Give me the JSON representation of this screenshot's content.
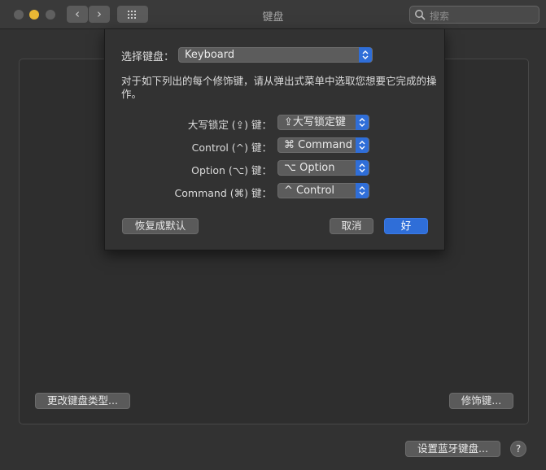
{
  "window": {
    "title": "键盘",
    "search_placeholder": "搜索"
  },
  "panel": {
    "change_type_label": "更改键盘类型...",
    "modifier_label": "修饰键...",
    "bluetooth_label": "设置蓝牙键盘...",
    "help_label": "?"
  },
  "sheet": {
    "select_label": "选择键盘：",
    "keyboard_value": "Keyboard",
    "description": "对于如下列出的每个修饰键，请从弹出式菜单中选取您想要它完成的操作。",
    "rows": [
      {
        "label": "大写锁定 (⇪) 键：",
        "value": "⇪大写锁定键"
      },
      {
        "label": "Control (^) 键：",
        "value": "⌘ Command"
      },
      {
        "label": "Option (⌥) 键：",
        "value": "⌥ Option"
      },
      {
        "label": "Command (⌘) 键：",
        "value": "^ Control"
      }
    ],
    "restore_label": "恢复成默认",
    "cancel_label": "取消",
    "ok_label": "好"
  },
  "colors": {
    "accent": "#2f6ed8",
    "background": "#323232"
  }
}
